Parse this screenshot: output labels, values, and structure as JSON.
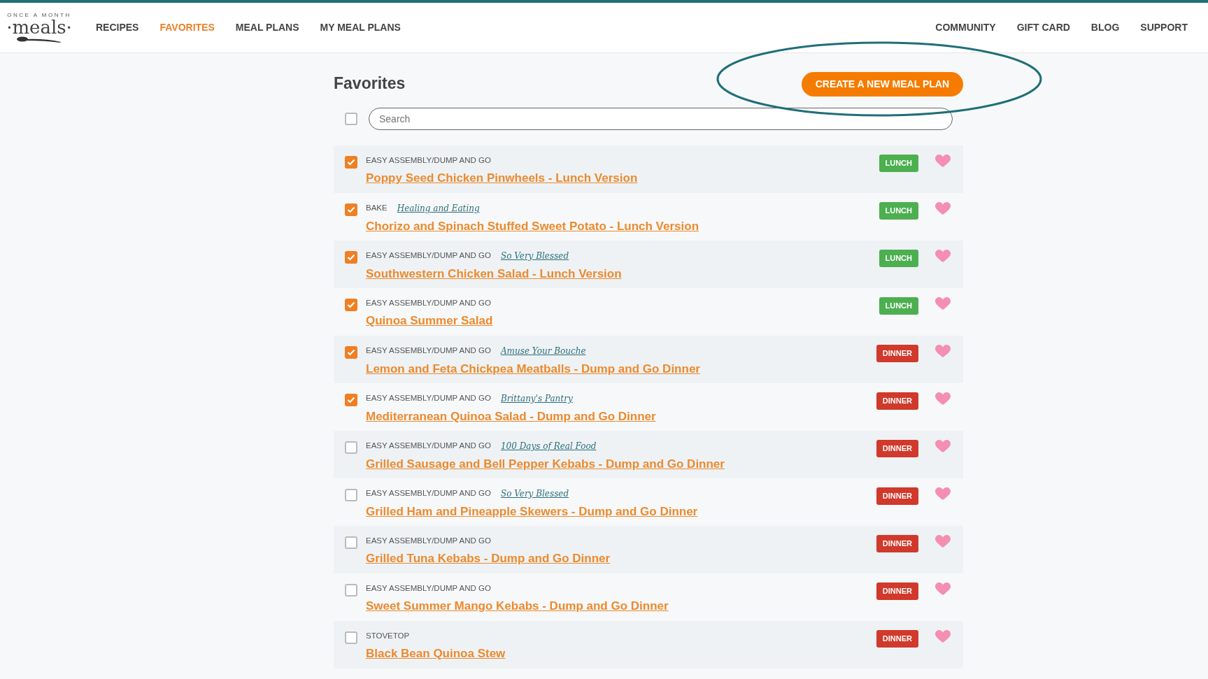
{
  "logo": {
    "tagline": "ONCE A MONTH",
    "wordmark": "·meals·"
  },
  "nav_left": [
    {
      "label": "RECIPES",
      "selected": false
    },
    {
      "label": "FAVORITES",
      "selected": true
    },
    {
      "label": "MEAL PLANS",
      "selected": false
    },
    {
      "label": "MY MEAL PLANS",
      "selected": false
    }
  ],
  "nav_right": [
    "COMMUNITY",
    "GIFT CARD",
    "BLOG",
    "SUPPORT"
  ],
  "page_title": "Favorites",
  "create_button": "CREATE A NEW MEAL PLAN",
  "select_all": {
    "checked": false
  },
  "search": {
    "placeholder": "Search"
  },
  "recipes": [
    {
      "checked": true,
      "category": "EASY ASSEMBLY/DUMP AND GO",
      "title": "Poppy Seed Chicken Pinwheels - Lunch Version",
      "tag": "LUNCH",
      "color": "#4caf50"
    },
    {
      "checked": true,
      "category": "BAKE",
      "source": "Healing and Eating",
      "title": "Chorizo and Spinach Stuffed Sweet Potato - Lunch Version",
      "tag": "LUNCH",
      "color": "#4caf50"
    },
    {
      "checked": true,
      "category": "EASY ASSEMBLY/DUMP AND GO",
      "source": "So Very Blessed",
      "title": "Southwestern Chicken Salad - Lunch Version",
      "tag": "LUNCH",
      "color": "#4caf50"
    },
    {
      "checked": true,
      "category": "EASY ASSEMBLY/DUMP AND GO",
      "title": "Quinoa Summer Salad",
      "tag": "LUNCH",
      "color": "#4caf50"
    },
    {
      "checked": true,
      "category": "EASY ASSEMBLY/DUMP AND GO",
      "source": "Amuse Your Bouche",
      "title": "Lemon and Feta Chickpea Meatballs - Dump and Go Dinner",
      "tag": "DINNER",
      "color": "#d0392b"
    },
    {
      "checked": true,
      "category": "EASY ASSEMBLY/DUMP AND GO",
      "source": "Brittany's Pantry",
      "title": "Mediterranean Quinoa Salad - Dump and Go Dinner",
      "tag": "DINNER",
      "color": "#d0392b"
    },
    {
      "checked": false,
      "category": "EASY ASSEMBLY/DUMP AND GO",
      "source": "100 Days of Real Food",
      "title": "Grilled Sausage and Bell Pepper Kebabs - Dump and Go Dinner",
      "tag": "DINNER",
      "color": "#d0392b"
    },
    {
      "checked": false,
      "category": "EASY ASSEMBLY/DUMP AND GO",
      "source": "So Very Blessed",
      "title": "Grilled Ham and Pineapple Skewers - Dump and Go Dinner",
      "tag": "DINNER",
      "color": "#d0392b"
    },
    {
      "checked": false,
      "category": "EASY ASSEMBLY/DUMP AND GO",
      "title": "Grilled Tuna Kebabs - Dump and Go Dinner",
      "tag": "DINNER",
      "color": "#d0392b"
    },
    {
      "checked": false,
      "category": "EASY ASSEMBLY/DUMP AND GO",
      "title": "Sweet Summer Mango Kebabs - Dump and Go Dinner",
      "tag": "DINNER",
      "color": "#d0392b"
    },
    {
      "checked": false,
      "category": "STOVETOP",
      "title": "Black Bean Quinoa Stew",
      "tag": "DINNER",
      "color": "#d0392b"
    }
  ]
}
